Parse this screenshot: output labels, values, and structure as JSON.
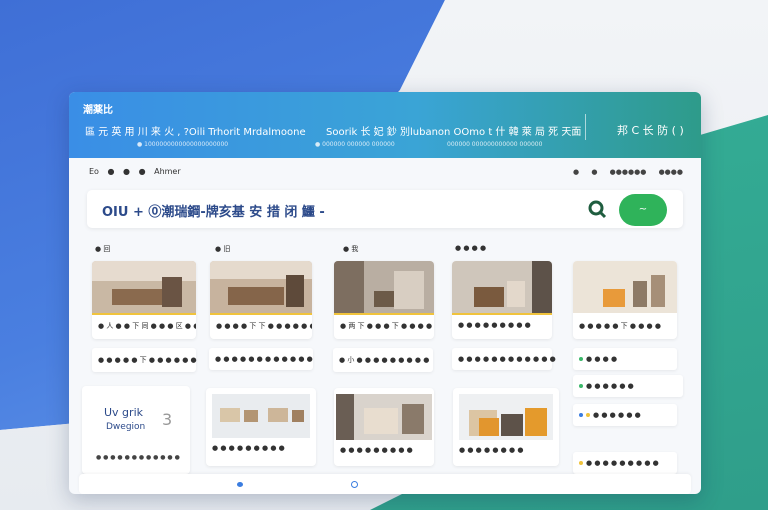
{
  "header": {
    "title": "潮薬比",
    "subtitle_left": "區 元 英 用 川 来 火 , ?Oili  Trhorit   Mrdalmoone",
    "subtitle_mid": "Soorik  长 妃 鈔 別lubanon  OOmo t 什 韓 萊 局 死 天面",
    "meta_left": "● 1000000000000000000000",
    "meta_mid": "● 000000 000000 000000",
    "meta_right": "000000 000000000000 000000",
    "right_label": "邦 C 长 防 ( )"
  },
  "toolbar": {
    "left_items": [
      "Eo",
      "●",
      "●",
      "●",
      "Ahmer"
    ],
    "right_items": [
      "●",
      "●",
      "●●●●●●",
      "●●●●"
    ]
  },
  "search": {
    "value": "OIU  + ⓪潮瑞鋼-牌亥基 安 措 闭 鱷 -",
    "chat_label": "~"
  },
  "cards_row1": [
    {
      "label": "● 回",
      "caption": "● 人 ● ● 下 同 ● ● ● 区 ● ●"
    },
    {
      "label": "● 旧",
      "caption": "● ● ● ● 下 下 ● ● ● ● ● ●"
    },
    {
      "label": "● 我",
      "caption": "● 两 下 ● ● ● 下 ● ● ● ● ●"
    },
    {
      "label": "● ● ● ●",
      "caption": "● ● ● ● ● ● ● ● ●"
    },
    {
      "label": "",
      "caption": "● ● ● ● ● 下 ● ● ● ●"
    }
  ],
  "pills_row1": [
    "● ● ● ● ● 下 ● ● ● ● ● ●",
    "● ● ● ● ● ● ● ● ● ● ● ●",
    "● 小 ● ● ● ● ● ● ● ● ●",
    "● ● ● ● ● ● ● ● ● ● ● ●",
    "● ● ● ●"
  ],
  "side_pill": "● ● ● ● ● ●",
  "design_card": {
    "title": "Uv grik",
    "subtitle": "Dwegion",
    "number": "3",
    "caption": "● ● ● ● ● ● ● ● ● ● ● ●"
  },
  "cards_row2_captions": [
    "● ● ● ● ● ● ● ● ●",
    "● ● ● ● ● ● ● ● ●",
    "● ● ● ● ● ● ● ●"
  ],
  "side_pills_row2": [
    "● ●  ● ● ● ●",
    "● ● ● ● ● ● ● ● ●"
  ],
  "colors": {
    "accent_blue": "#3a7de0",
    "accent_teal": "#2e9b8a",
    "accent_yellow": "#f0c33c",
    "accent_green": "#2fb35a"
  }
}
